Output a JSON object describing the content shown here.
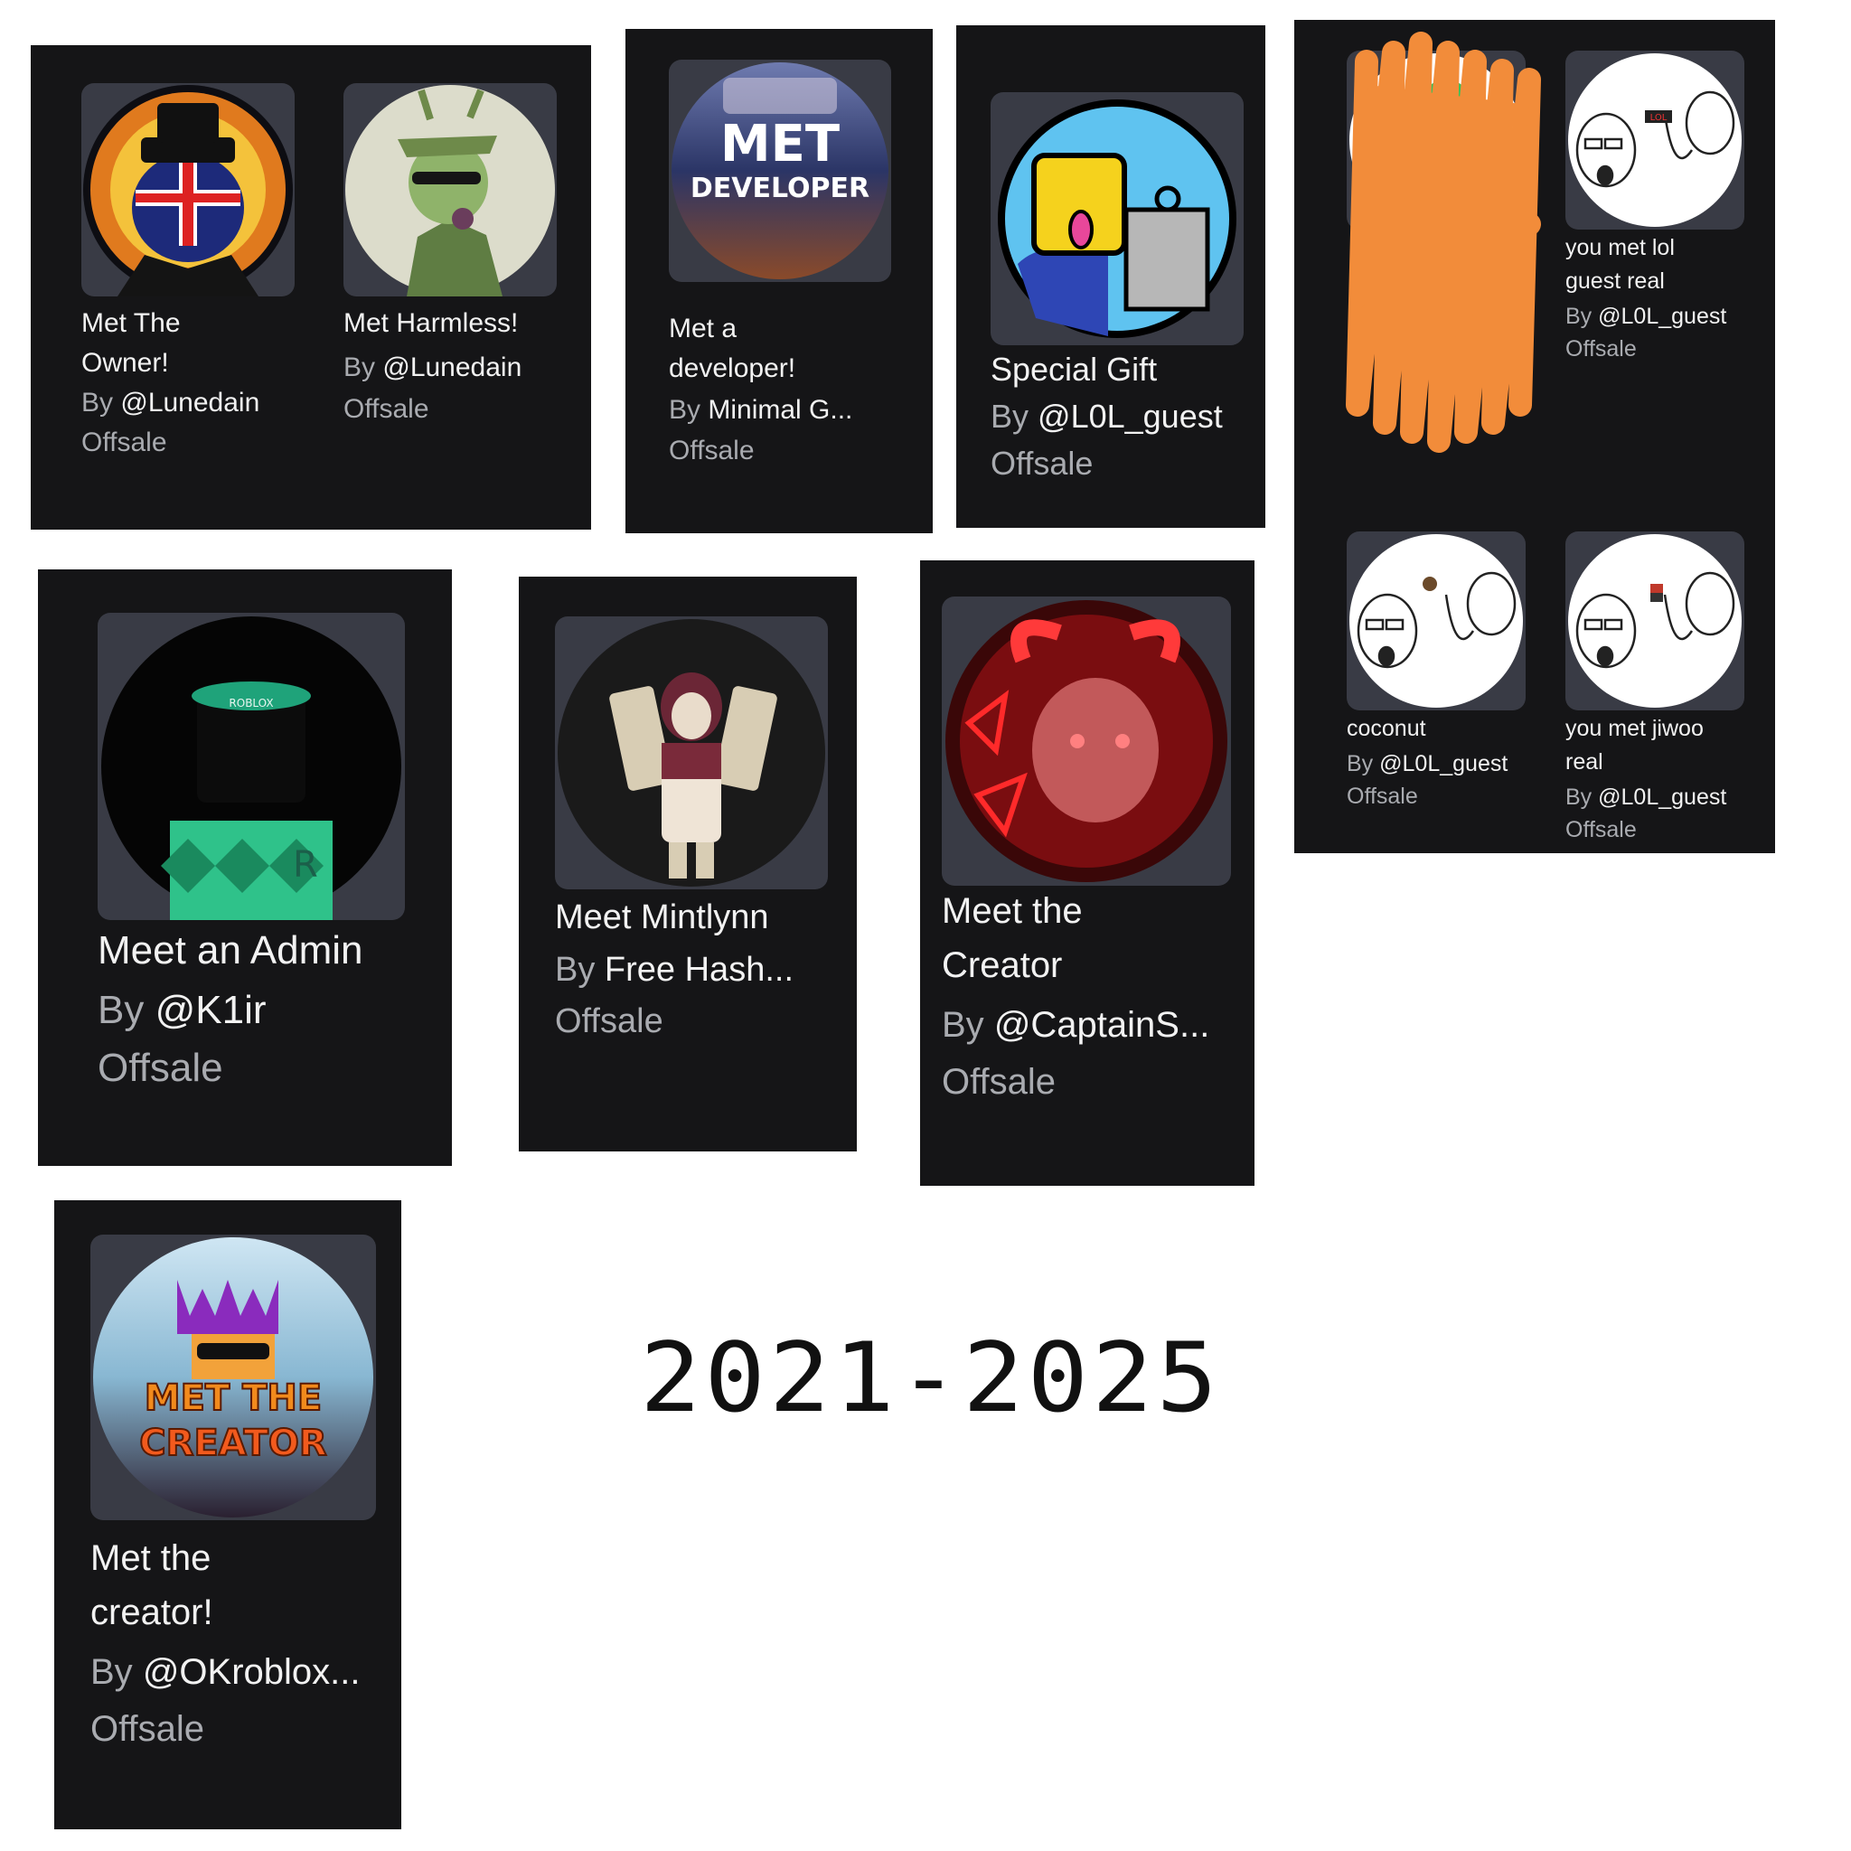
{
  "year_range": "2021-2025",
  "items": [
    {
      "id": "met-the-owner",
      "title_lines": [
        "Met The",
        "Owner!"
      ],
      "by": "By",
      "creator": "@Lunedain",
      "status": "Offsale",
      "icon": "owner-badge-icon"
    },
    {
      "id": "met-harmless",
      "title_lines": [
        "Met Harmless!"
      ],
      "by": "By",
      "creator": "@Lunedain",
      "status": "Offsale",
      "icon": "harmless-badge-icon"
    },
    {
      "id": "met-a-developer",
      "title_lines": [
        "Met a",
        "developer!"
      ],
      "by": "By",
      "creator": "Minimal G...",
      "status": "Offsale",
      "icon": "developer-badge-icon",
      "thumb_text": [
        "MET",
        "DEVELOPER"
      ]
    },
    {
      "id": "special-gift",
      "title_lines": [
        "Special Gift"
      ],
      "by": "By",
      "creator": "@L0L_guest",
      "status": "Offsale",
      "icon": "special-gift-badge-icon"
    },
    {
      "id": "scribbled-badge",
      "title_lines": [],
      "by": "",
      "creator": "",
      "status": "",
      "icon": "scribbled-out-badge-icon"
    },
    {
      "id": "you-met-lol-guest-real",
      "title_lines": [
        "you met lol",
        "guest real"
      ],
      "by": "By",
      "creator": "@L0L_guest",
      "status": "Offsale",
      "icon": "wojak-pointing-lol-icon",
      "thumb_text": [
        "LOL"
      ]
    },
    {
      "id": "coconut",
      "title_lines": [
        "coconut"
      ],
      "by": "By",
      "creator": "@L0L_guest",
      "status": "Offsale",
      "icon": "wojak-pointing-coconut-icon"
    },
    {
      "id": "you-met-jiwoo-real",
      "title_lines": [
        "you met jiwoo",
        "real"
      ],
      "by": "By",
      "creator": "@L0L_guest",
      "status": "Offsale",
      "icon": "wojak-pointing-jiwoo-icon"
    },
    {
      "id": "meet-an-admin",
      "title_lines": [
        "Meet an Admin"
      ],
      "by": "By",
      "creator": "@K1ir",
      "status": "Offsale",
      "icon": "admin-badge-icon",
      "thumb_text": [
        "ROBLOX",
        "R"
      ]
    },
    {
      "id": "meet-mintlynn",
      "title_lines": [
        "Meet Mintlynn"
      ],
      "by": "By",
      "creator": "Free Hash...",
      "status": "Offsale",
      "icon": "mintlynn-badge-icon"
    },
    {
      "id": "meet-the-creator",
      "title_lines": [
        "Meet the",
        "Creator"
      ],
      "by": "By",
      "creator": "@CaptainS...",
      "status": "Offsale",
      "icon": "creator-red-badge-icon"
    },
    {
      "id": "met-the-creator",
      "title_lines": [
        "Met the",
        "creator!"
      ],
      "by": "By",
      "creator": "@OKroblox...",
      "status": "Offsale",
      "icon": "met-the-creator-badge-icon",
      "thumb_text": [
        "MET THE",
        "CREATOR"
      ]
    }
  ],
  "colors": {
    "panel": "#151517",
    "thumb_bg": "#393b45",
    "title": "#f2f2f2",
    "muted": "#a9abb0",
    "scribble": "#f28c3a"
  }
}
